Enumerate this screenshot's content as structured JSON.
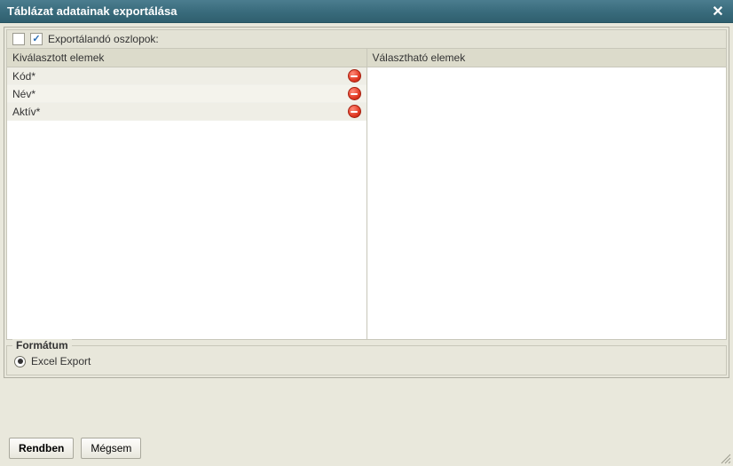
{
  "titlebar": {
    "title": "Táblázat adatainak exportálása"
  },
  "columns_section": {
    "label": "Exportálandó oszlopok:",
    "selected_header": "Kiválasztott elemek",
    "available_header": "Választható elemek",
    "selected_items": [
      {
        "label": "Kód*"
      },
      {
        "label": "Név*"
      },
      {
        "label": "Aktív*"
      }
    ],
    "available_items": []
  },
  "format": {
    "legend": "Formátum",
    "options": [
      {
        "label": "Excel Export",
        "checked": true
      }
    ]
  },
  "buttons": {
    "ok": "Rendben",
    "cancel": "Mégsem"
  }
}
